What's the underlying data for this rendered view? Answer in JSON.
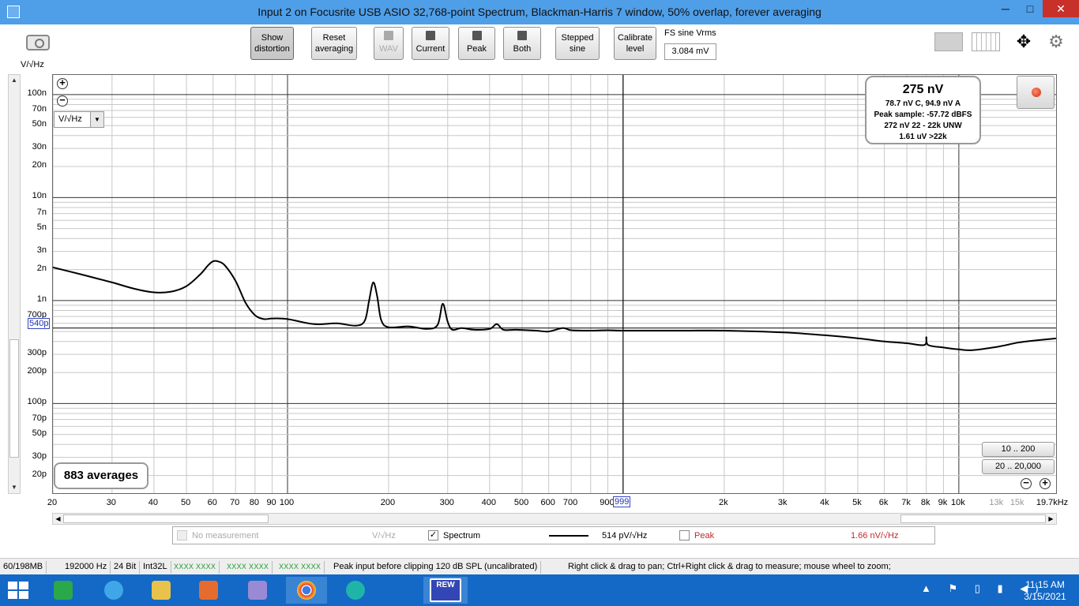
{
  "window": {
    "title": "Input 2 on Focusrite USB ASIO 32,768-point Spectrum, Blackman-Harris 7 window, 50% overlap, forever averaging",
    "minimize": "─",
    "maximize": "□",
    "close": "✕"
  },
  "toolbar": {
    "show_distortion": [
      "Show",
      "distortion"
    ],
    "reset_averaging": [
      "Reset",
      "averaging"
    ],
    "wav": "WAV",
    "current": "Current",
    "peak": "Peak",
    "both": "Both",
    "stepped_sine": [
      "Stepped",
      "sine"
    ],
    "calibrate_level": [
      "Calibrate",
      "level"
    ],
    "fs_label": "FS sine Vrms",
    "fs_value": "3.084 mV"
  },
  "icons": {
    "camera": "camera-icon",
    "layout": "panel-layout-icon",
    "columns": "columns-icon",
    "fit": "fit-arrows-icon",
    "settings": "gear-icon"
  },
  "plot": {
    "y_unit_label": "V/√Hz",
    "unit_select": "V/√Hz",
    "cursor_y": "540p",
    "cursor_x": "999",
    "stats": {
      "main": "275 nV",
      "line1": "78.7 nV C, 94.9 nV A",
      "line2": "Peak sample: -57.72 dBFS",
      "line3": "272 nV 22 - 22k UNW",
      "line4": "1.61 uV >22k"
    },
    "averages": "883 averages",
    "range_btn1": "10 .. 200",
    "range_btn2": "20 .. 20,000",
    "zoom_in": "+",
    "zoom_out": "−"
  },
  "chart_data": {
    "type": "line",
    "title": "",
    "xlabel": "",
    "ylabel": "V/√Hz",
    "x_scale": "log",
    "y_scale": "log",
    "xlim": [
      20,
      19700
    ],
    "ylim": [
      1.3e-11,
      1.55e-07
    ],
    "grid": true,
    "y_tick_labels": [
      {
        "v": 1e-07,
        "t": "100n"
      },
      {
        "v": 7e-08,
        "t": "70n"
      },
      {
        "v": 5e-08,
        "t": "50n"
      },
      {
        "v": 3e-08,
        "t": "30n"
      },
      {
        "v": 2e-08,
        "t": "20n"
      },
      {
        "v": 1e-08,
        "t": "10n"
      },
      {
        "v": 7e-09,
        "t": "7n"
      },
      {
        "v": 5e-09,
        "t": "5n"
      },
      {
        "v": 3e-09,
        "t": "3n"
      },
      {
        "v": 2e-09,
        "t": "2n"
      },
      {
        "v": 1e-09,
        "t": "1n"
      },
      {
        "v": 7e-10,
        "t": "700p"
      },
      {
        "v": 3e-10,
        "t": "300p"
      },
      {
        "v": 2e-10,
        "t": "200p"
      },
      {
        "v": 1e-10,
        "t": "100p"
      },
      {
        "v": 7e-11,
        "t": "70p"
      },
      {
        "v": 5e-11,
        "t": "50p"
      },
      {
        "v": 3e-11,
        "t": "30p"
      },
      {
        "v": 2e-11,
        "t": "20p"
      }
    ],
    "x_tick_labels": [
      {
        "v": 20,
        "t": "20"
      },
      {
        "v": 30,
        "t": "30"
      },
      {
        "v": 40,
        "t": "40"
      },
      {
        "v": 50,
        "t": "50"
      },
      {
        "v": 60,
        "t": "60"
      },
      {
        "v": 70,
        "t": "70"
      },
      {
        "v": 80,
        "t": "80"
      },
      {
        "v": 90,
        "t": "90"
      },
      {
        "v": 100,
        "t": "100"
      },
      {
        "v": 200,
        "t": "200"
      },
      {
        "v": 300,
        "t": "300"
      },
      {
        "v": 400,
        "t": "400"
      },
      {
        "v": 500,
        "t": "500"
      },
      {
        "v": 600,
        "t": "600"
      },
      {
        "v": 700,
        "t": "700"
      },
      {
        "v": 900,
        "t": "900"
      },
      {
        "v": 2000,
        "t": "2k"
      },
      {
        "v": 3000,
        "t": "3k"
      },
      {
        "v": 4000,
        "t": "4k"
      },
      {
        "v": 5000,
        "t": "5k"
      },
      {
        "v": 6000,
        "t": "6k"
      },
      {
        "v": 7000,
        "t": "7k"
      },
      {
        "v": 8000,
        "t": "8k"
      },
      {
        "v": 9000,
        "t": "9k"
      },
      {
        "v": 10000,
        "t": "10k"
      },
      {
        "v": 13000,
        "t": "13k",
        "dim": true
      },
      {
        "v": 15000,
        "t": "15k",
        "dim": true
      },
      {
        "v": 19700,
        "t": "19.7kHz"
      }
    ],
    "cursor": {
      "x": 999,
      "y": 5.4e-10
    },
    "series": [
      {
        "name": "Spectrum",
        "color": "#000000",
        "x": [
          20,
          25,
          30,
          35,
          40,
          45,
          50,
          55,
          58,
          60,
          62,
          65,
          70,
          75,
          80,
          85,
          90,
          100,
          120,
          140,
          160,
          170,
          175,
          180,
          185,
          190,
          200,
          230,
          260,
          280,
          290,
          300,
          310,
          330,
          360,
          400,
          420,
          440,
          480,
          550,
          600,
          660,
          700,
          800,
          900,
          1000,
          1500,
          2000,
          3000,
          4000,
          5000,
          6000,
          7000,
          7900,
          8000,
          8100,
          9000,
          10000,
          11000,
          13000,
          15000,
          17000,
          19700
        ],
        "y": [
          2.1e-09,
          1.75e-09,
          1.5e-09,
          1.3e-09,
          1.2e-09,
          1.22e-09,
          1.38e-09,
          1.8e-09,
          2.2e-09,
          2.4e-09,
          2.4e-09,
          2.2e-09,
          1.55e-09,
          9.5e-10,
          7.2e-10,
          6.6e-10,
          6.7e-10,
          6.6e-10,
          5.9e-10,
          6e-10,
          5.7e-10,
          6.4e-10,
          1e-09,
          1.5e-09,
          1.1e-09,
          6.5e-10,
          5.5e-10,
          5.6e-10,
          5.3e-10,
          5.8e-10,
          9.3e-10,
          6.2e-10,
          5.2e-10,
          5.4e-10,
          5.2e-10,
          5.3e-10,
          5.9e-10,
          5.2e-10,
          5.2e-10,
          5.1e-10,
          5e-10,
          5.4e-10,
          5.15e-10,
          5.1e-10,
          5.15e-10,
          5.1e-10,
          5.1e-10,
          5.1e-10,
          4.9e-10,
          4.6e-10,
          4.3e-10,
          4e-10,
          3.85e-10,
          3.7e-10,
          4.4e-10,
          3.7e-10,
          3.5e-10,
          3.35e-10,
          3.3e-10,
          3.55e-10,
          3.9e-10,
          4.1e-10,
          4.3e-10
        ]
      }
    ]
  },
  "hscroll": {
    "left": "◀",
    "right": "▶"
  },
  "vscroll": {
    "up": "▲",
    "down": "▼"
  },
  "legend": {
    "no_measurement": "No measurement",
    "no_measurement_unit": "V/√Hz",
    "spectrum_label": "Spectrum",
    "spectrum_value": "514 pV/√Hz",
    "peak_label": "Peak",
    "peak_value": "1.66 nV/√Hz",
    "spectrum_checked": "✓"
  },
  "statusbar": {
    "memory": "60/198MB",
    "rate": "192000 Hz",
    "bits": "24 Bit",
    "format": "Int32L",
    "meter1": "XXXX XXXX",
    "meter2": "XXXX XXXX",
    "meter3": "XXXX XXXX",
    "peak_input": "Peak input before clipping 120 dB SPL (uncalibrated)",
    "hint": "Right click & drag to pan; Ctrl+Right click & drag to measure; mouse wheel to zoom;"
  },
  "taskbar": {
    "time": "11:15 AM",
    "date": "3/15/2021",
    "rew_label": "REW",
    "tray": "▲ ⚑ ▯ ▮ ◀)"
  }
}
